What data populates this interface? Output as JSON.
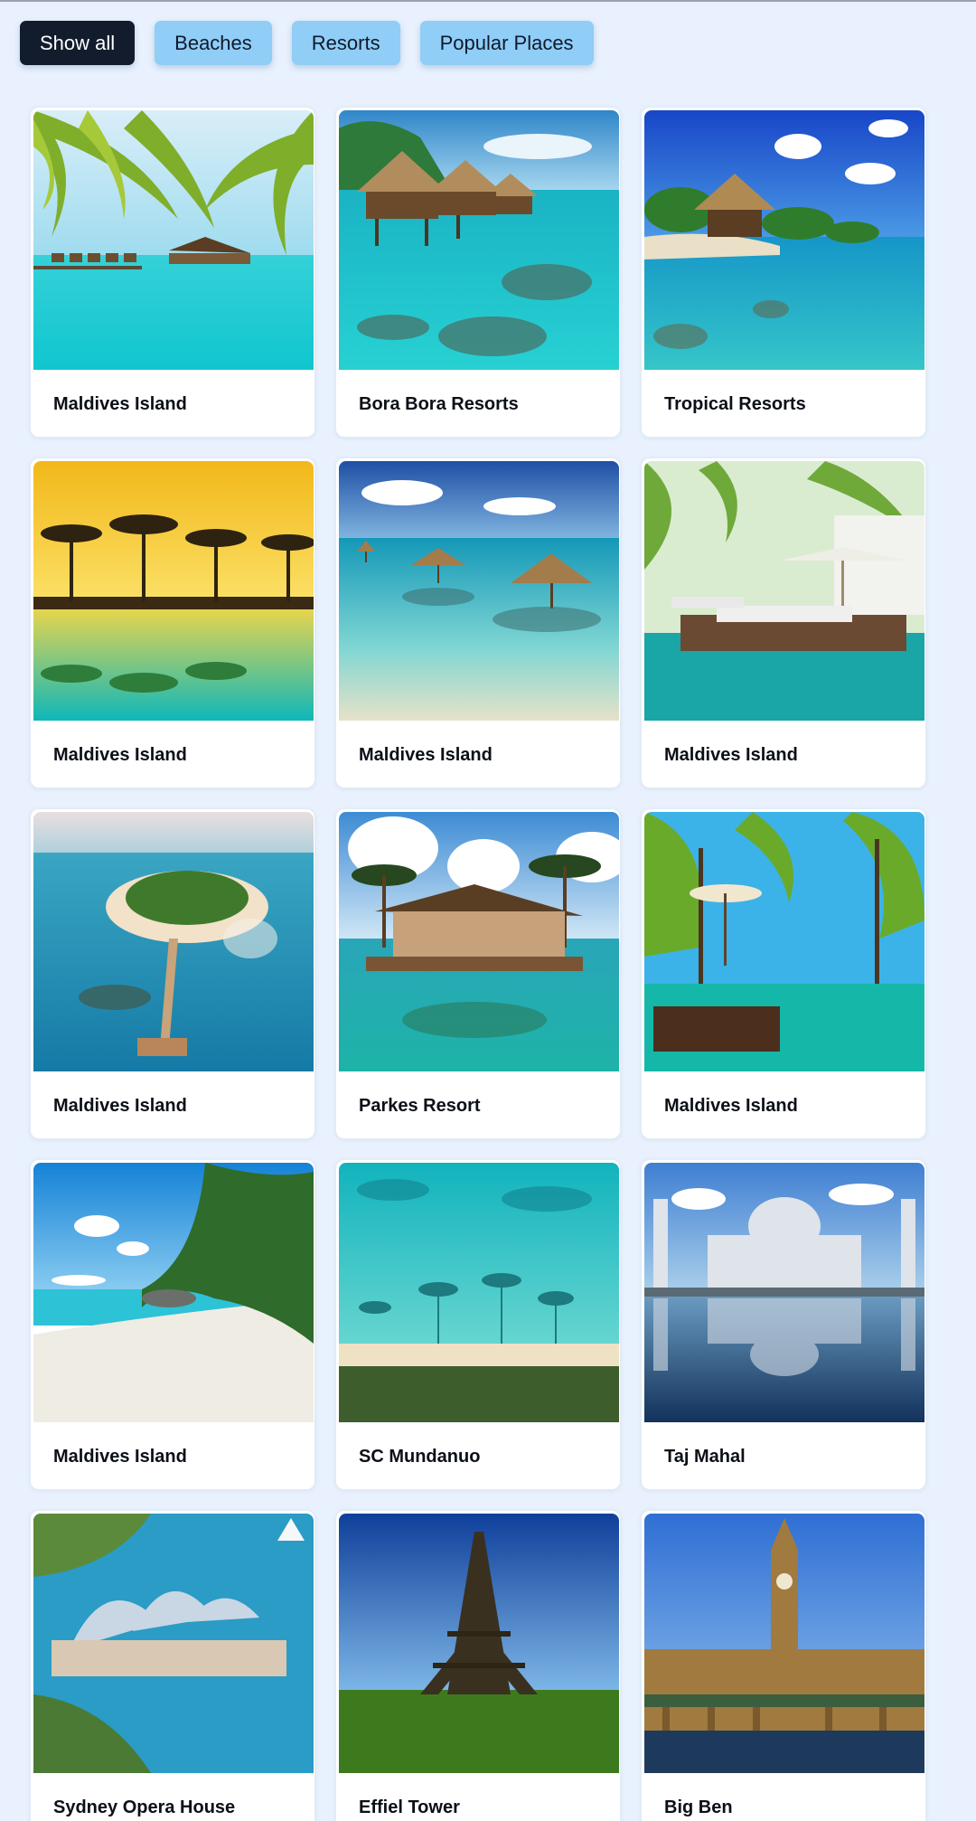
{
  "filters": [
    {
      "label": "Show all",
      "active": true
    },
    {
      "label": "Beaches",
      "active": false
    },
    {
      "label": "Resorts",
      "active": false
    },
    {
      "label": "Popular Places",
      "active": false
    }
  ],
  "cards": [
    {
      "title": "Maldives Island"
    },
    {
      "title": "Bora Bora Resorts"
    },
    {
      "title": "Tropical Resorts"
    },
    {
      "title": "Maldives Island"
    },
    {
      "title": "Maldives Island"
    },
    {
      "title": "Maldives Island"
    },
    {
      "title": "Maldives Island"
    },
    {
      "title": "Parkes Resort"
    },
    {
      "title": "Maldives Island"
    },
    {
      "title": "Maldives Island"
    },
    {
      "title": "SC Mundanuo"
    },
    {
      "title": "Taj Mahal"
    },
    {
      "title": "Sydney Opera House"
    },
    {
      "title": "Effiel Tower"
    },
    {
      "title": "Big Ben"
    }
  ],
  "colors": {
    "page_background": "#e8f1fd",
    "filter_active": "#121c2d",
    "filter_inactive": "#90cdf7"
  }
}
